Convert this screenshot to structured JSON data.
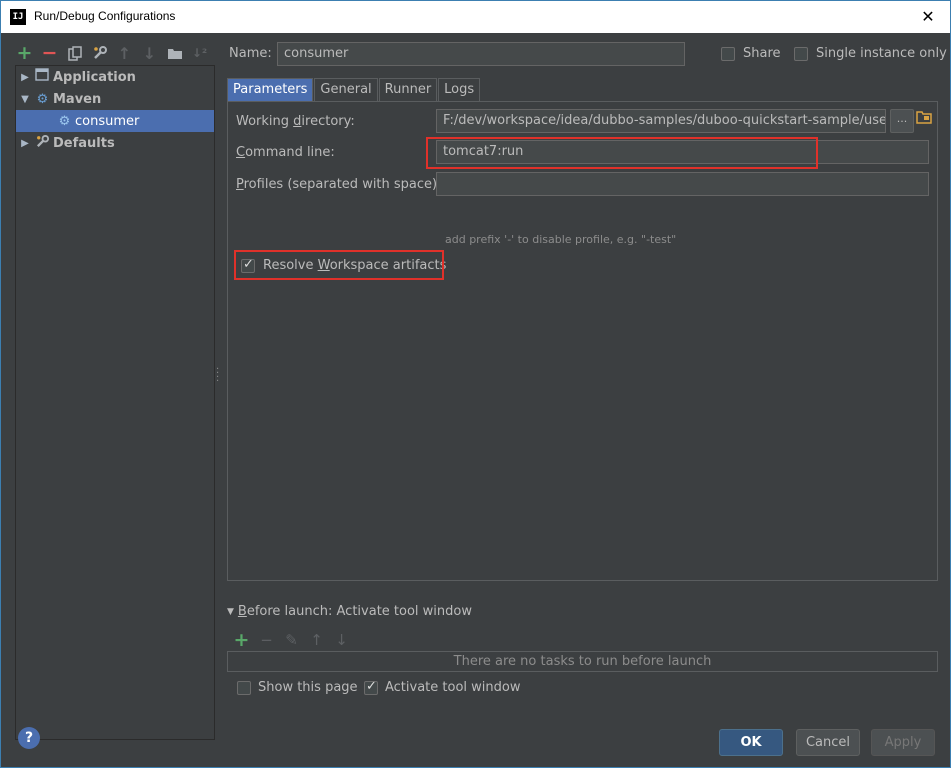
{
  "window": {
    "title": "Run/Debug Configurations",
    "app_icon": "IJ",
    "close_glyph": "✕"
  },
  "toolbar": {
    "icons": [
      "add-icon",
      "remove-icon",
      "copy-icon",
      "wrench-icon",
      "move-up-icon",
      "move-down-icon",
      "folder-icon",
      "sort-icon"
    ]
  },
  "tree": {
    "items": [
      {
        "label": "Application",
        "expanded": false
      },
      {
        "label": "Maven",
        "expanded": true
      },
      {
        "label": "consumer",
        "selected": true
      },
      {
        "label": "Defaults",
        "expanded": false
      }
    ]
  },
  "name": {
    "label": "Name:",
    "value": "consumer"
  },
  "share": {
    "label": "Share",
    "checked": false
  },
  "single_instance": {
    "label": "Single instance only",
    "checked": false
  },
  "tabs": [
    {
      "label": "Parameters",
      "active": true
    },
    {
      "label": "General",
      "active": false
    },
    {
      "label": "Runner",
      "active": false
    },
    {
      "label": "Logs",
      "active": false
    }
  ],
  "parameters": {
    "working_directory": {
      "label_pre": "Working ",
      "label_u": "d",
      "label_post": "irectory:",
      "value": "F:/dev/workspace/idea/dubbo-samples/duboo-quickstart-sample/user",
      "browse": "..."
    },
    "command_line": {
      "label_u": "C",
      "label_post": "ommand line:",
      "value": "tomcat7:run"
    },
    "profiles": {
      "label_u": "P",
      "label_post": "rofiles (separated with space):",
      "value": "",
      "hint": "add prefix '-' to disable profile, e.g. \"-test\""
    },
    "resolve": {
      "label_pre": "Resolve ",
      "label_u": "W",
      "label_post": "orkspace artifacts",
      "checked": true
    }
  },
  "before_launch": {
    "title_u": "B",
    "title_post": "efore launch: Activate tool window",
    "empty_text": "There are no tasks to run before launch",
    "show_page": {
      "label": "Show this page",
      "checked": false
    },
    "activate": {
      "label": "Activate tool window",
      "checked": true
    }
  },
  "buttons": {
    "ok": "OK",
    "cancel": "Cancel",
    "apply": "Apply",
    "help": "?"
  },
  "colors": {
    "background": "#3c3f41",
    "selection": "#4b6eaf",
    "highlight": "#e0312a",
    "add": "#59a869",
    "remove": "#e05555"
  }
}
